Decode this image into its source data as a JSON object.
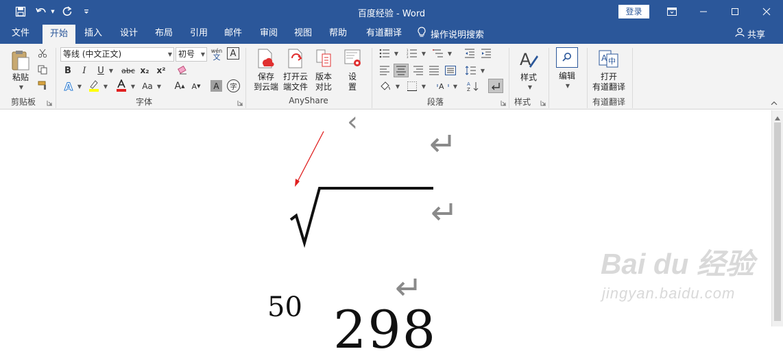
{
  "window": {
    "title": "百度经验  -  Word",
    "login_label": "登录"
  },
  "tabs": [
    {
      "label": "文件"
    },
    {
      "label": "开始",
      "active": true
    },
    {
      "label": "插入"
    },
    {
      "label": "设计"
    },
    {
      "label": "布局"
    },
    {
      "label": "引用"
    },
    {
      "label": "邮件"
    },
    {
      "label": "审阅"
    },
    {
      "label": "视图"
    },
    {
      "label": "帮助"
    },
    {
      "label": "有道翻译"
    }
  ],
  "tell_me": {
    "label": "操作说明搜索"
  },
  "share": {
    "label": "共享"
  },
  "ribbon": {
    "clipboard": {
      "paste_label": "粘贴",
      "group_label": "剪贴板"
    },
    "font": {
      "font_name": "等线 (中文正文)",
      "font_size": "初号",
      "phonetic_top": "wén",
      "phonetic_bottom": "文",
      "border_char": "A",
      "bold": "B",
      "italic": "I",
      "underline": "U",
      "strike": "abc",
      "subscript": "x₂",
      "superscript": "x²",
      "grow": "A",
      "shrink": "A",
      "shade_char": "A",
      "enclose_char": "字",
      "group_label": "字体"
    },
    "anyshare": {
      "save_cloud": [
        "保存",
        "到云端"
      ],
      "open_cloud": [
        "打开云",
        "端文件"
      ],
      "version_compare": [
        "版本",
        "对比"
      ],
      "settings": [
        "设",
        "置"
      ],
      "group_label": "AnyShare"
    },
    "paragraph": {
      "group_label": "段落"
    },
    "styles": {
      "label": "样式",
      "group_label": "样式"
    },
    "editing": {
      "label": "编辑"
    },
    "youdao": {
      "open_label": [
        "打开",
        "有道翻译"
      ],
      "group_label": "有道翻译"
    }
  },
  "document": {
    "equation_index": "50",
    "equation_radicand": "298",
    "paragraph_mark": "↵",
    "watermark_logo": "Bai du 经验",
    "watermark_url": "jingyan.baidu.com"
  },
  "colors": {
    "titlebar": "#2b579a",
    "ribbon_bg": "#f3f3f3",
    "annotation_arrow": "#e02020",
    "highlight_yellow": "#ffff00",
    "font_color_red": "#e02020"
  }
}
